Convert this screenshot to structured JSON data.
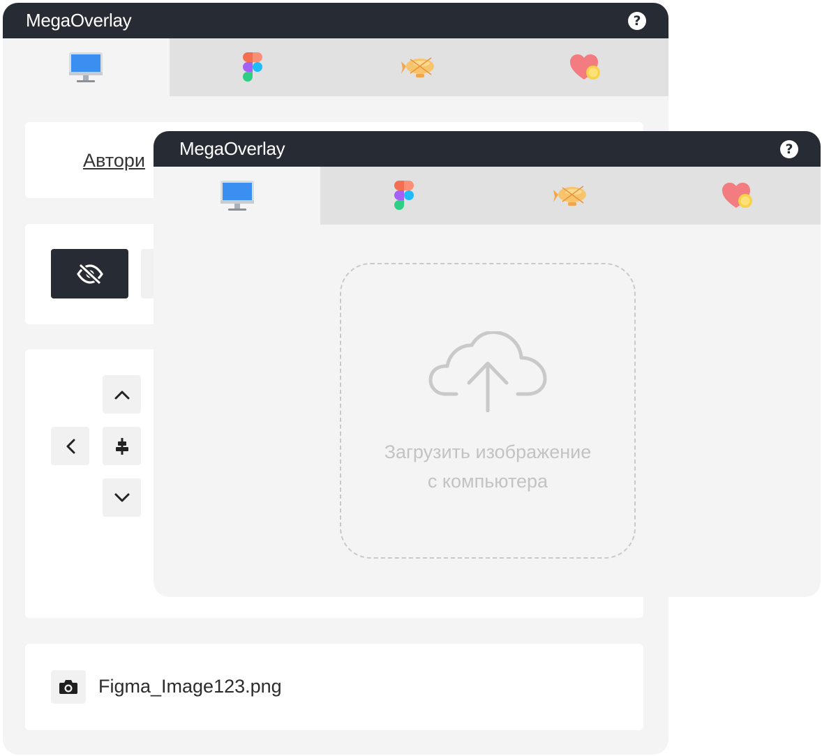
{
  "app": {
    "title": "MegaOverlay",
    "help_symbol": "?"
  },
  "tabs": [
    {
      "icon": "computer-monitor-icon",
      "active": true
    },
    {
      "icon": "figma-logo-icon",
      "active": false
    },
    {
      "icon": "airship-icon",
      "active": false
    },
    {
      "icon": "heart-coin-icon",
      "active": false
    }
  ],
  "back_panel": {
    "auth_link_partial": "Автори",
    "file_name": "Figma_Image123.png"
  },
  "dropzone": {
    "line1": "Загрузить изображение",
    "line2": "с компьютера"
  },
  "colors": {
    "titlebar": "#272b33",
    "panel_bg": "#f4f4f4",
    "tab_inactive": "#e1e1e1",
    "card_bg": "#ffffff",
    "button_dark": "#272b33"
  }
}
